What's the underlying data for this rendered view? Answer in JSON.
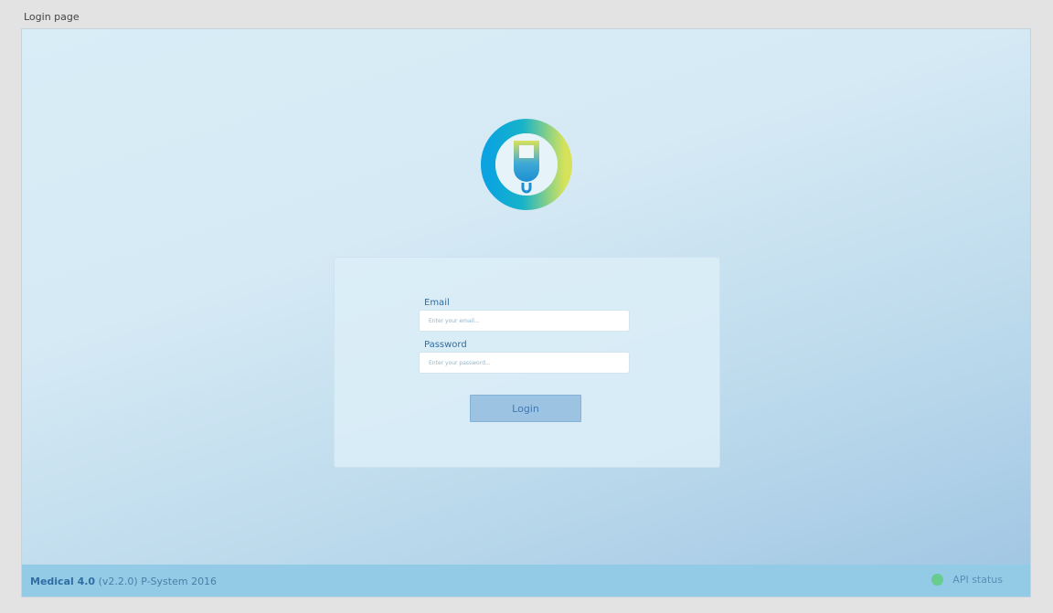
{
  "window": {
    "caption": "Login page"
  },
  "login_form": {
    "email_label": "Email",
    "email_placeholder": "Enter your email...",
    "email_value": "",
    "password_label": "Password",
    "password_placeholder": "Enter your password...",
    "password_value": "",
    "submit_label": "Login"
  },
  "footer": {
    "app_name": "Medical 4.0",
    "version": "(v2.2.0)",
    "company": "P-System 2016",
    "api_status_label": "API status",
    "api_status_color": "#68cc8e"
  },
  "icons": {
    "logo": "iv-bag-ring-logo-icon",
    "status": "status-dot-icon"
  },
  "colors": {
    "accent": "#2f6ea3",
    "logo_ring_start": "#0aa3e0",
    "logo_ring_end": "#d6e35a"
  }
}
